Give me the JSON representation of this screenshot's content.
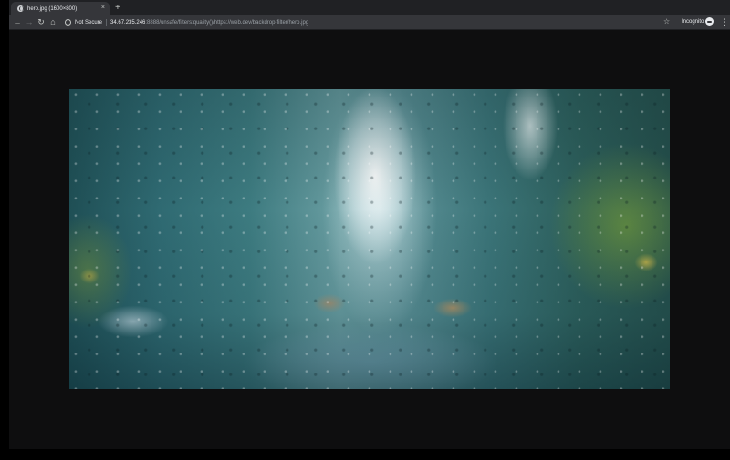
{
  "browser": {
    "tab": {
      "title": "hero.jpg (1600×800)",
      "close_glyph": "×",
      "favicon": "globe-icon"
    },
    "new_tab_glyph": "+",
    "nav": {
      "back_glyph": "←",
      "forward_glyph": "→",
      "reload_glyph": "↻",
      "home_glyph": "⌂"
    },
    "omnibox": {
      "security_label": "Not Secure",
      "url_host": "34.67.235.246",
      "url_rest": ":8888/unsafe/filters:quality()/https://web.dev/backdrop-filter/hero.jpg"
    },
    "bookmark_glyph": "☆",
    "incognito_label": "Incognito",
    "menu_glyph": "⋮"
  },
  "content": {
    "image_name": "hero.jpg"
  },
  "colors": {
    "tabstrip": "#202124",
    "toolbar": "#35363a",
    "page_background": "#0e0e0f",
    "text": "#e8eaed",
    "muted_text": "#9aa0a6"
  }
}
